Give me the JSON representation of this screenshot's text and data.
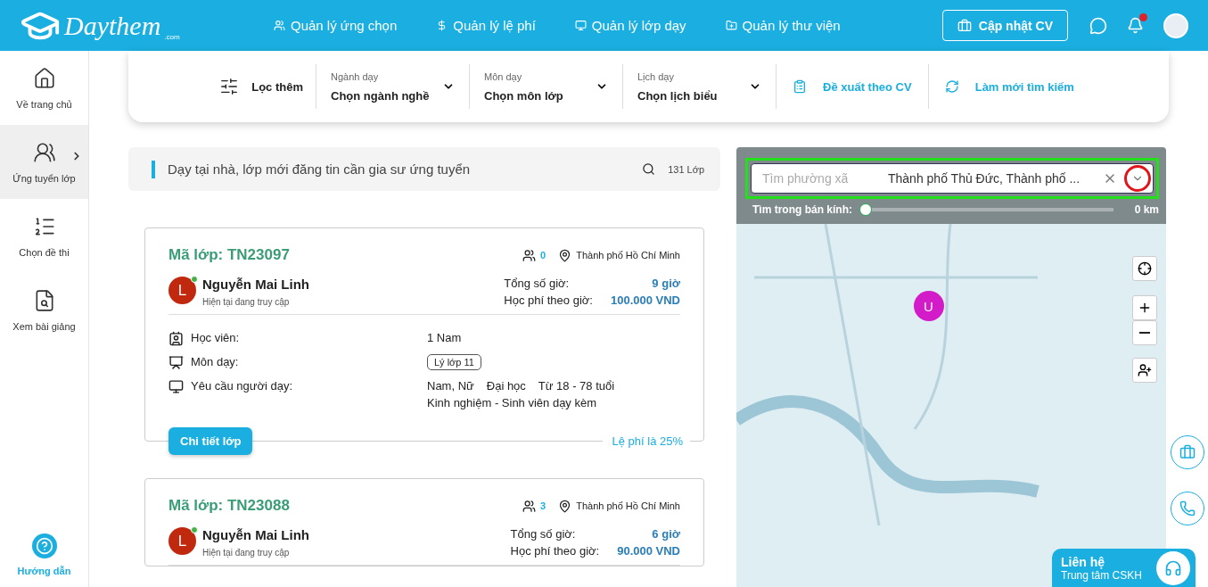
{
  "header": {
    "logo": {
      "name": "Daythem",
      "suffix": ".com"
    },
    "nav": [
      {
        "label": "Quản lý ứng chọn"
      },
      {
        "label": "Quản lý lệ phí"
      },
      {
        "label": "Quản lý lớp dạy"
      },
      {
        "label": "Quản lý thư viện"
      }
    ],
    "cv_button": "Cập nhật CV",
    "notification_unread": true
  },
  "sidebar": {
    "items": [
      {
        "label": "Về trang chủ",
        "selected": false
      },
      {
        "label": "Ứng tuyển lớp",
        "selected": true
      },
      {
        "label": "Chọn đề thi",
        "selected": false
      },
      {
        "label": "Xem bài giảng",
        "selected": false
      }
    ],
    "help": "Hướng dẫn"
  },
  "filters": {
    "more": "Lọc thêm",
    "dropdowns": [
      {
        "label": "Ngành dạy",
        "value": "Chọn ngành nghề"
      },
      {
        "label": "Môn dạy",
        "value": "Chọn môn lớp"
      },
      {
        "label": "Lịch dạy",
        "value": "Chọn lịch biểu"
      }
    ],
    "actions": [
      {
        "label": "Đề xuất theo CV"
      },
      {
        "label": "Làm mới tìm kiếm"
      }
    ]
  },
  "list_header": {
    "title": "Dạy tại nhà, lớp mới đăng tin cần gia sư ứng tuyển",
    "count": "131 Lớp"
  },
  "classes": [
    {
      "code": "Mã lớp: TN23097",
      "applicants": "0",
      "location": "Thành phố Hồ Chí Minh",
      "tutor": {
        "initial": "L",
        "name": "Nguyễn Mai Linh",
        "status": "Hiện tại đang truy cập",
        "online": true
      },
      "hours_label": "Tổng số giờ:",
      "hours": "9 giờ",
      "fee_label": "Học phí theo giờ:",
      "fee": "100.000 VND",
      "details": [
        {
          "label": "Học viên:",
          "values": [
            "1 Nam"
          ]
        },
        {
          "label": "Môn dạy:",
          "tag": "Lý lớp 11"
        },
        {
          "label": "Yêu cầu người dạy:",
          "values": [
            "Nam, Nữ",
            "Đại học",
            "Từ 18 - 78 tuổi"
          ],
          "note": "Kinh nghiệm - Sinh viên dạy kèm"
        }
      ],
      "button": "Chi tiết lớp",
      "fee_note": "Lệ phí là 25%"
    },
    {
      "code": "Mã lớp: TN23088",
      "applicants": "3",
      "location": "Thành phố Hồ Chí Minh",
      "tutor": {
        "initial": "L",
        "name": "Nguyễn Mai Linh",
        "status": "Hiện tại đang truy cập",
        "online": true
      },
      "hours_label": "Tổng số giờ:",
      "hours": "6 giờ",
      "fee_label": "Học phí theo giờ:",
      "fee": "90.000 VND"
    }
  ],
  "map": {
    "search": {
      "placeholder": "Tìm phường xã",
      "value": "Thành phố Thủ Đức, Thành phố ..."
    },
    "radius": {
      "label": "Tìm trong bán kính:",
      "level": 0,
      "reading": "0 km"
    },
    "marker": "U"
  },
  "contact": {
    "title": "Liên hệ",
    "subtitle": "Trung tâm CSKH"
  }
}
